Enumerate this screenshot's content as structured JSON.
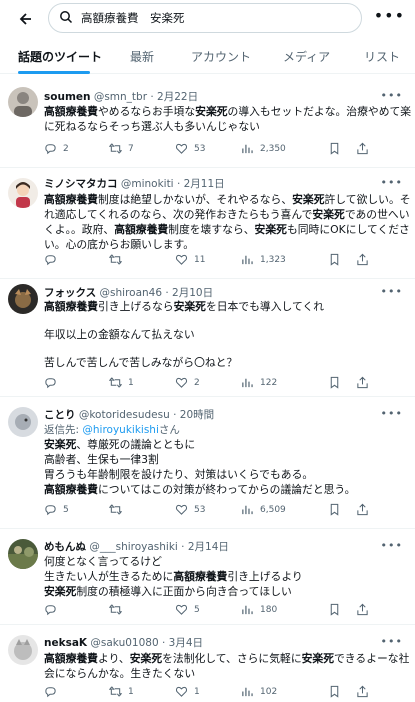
{
  "search": {
    "query": "高額療養費　安楽死"
  },
  "tabs": [
    "話題のツイート",
    "最新",
    "アカウント",
    "メディア",
    "リスト"
  ],
  "tweets": [
    {
      "name": "soumen",
      "handle": "@smn_tbr · 2月22日",
      "lines": [
        [
          {
            "t": "高額療養費",
            "b": true
          },
          {
            "t": "やめるならお手頃な"
          },
          {
            "t": "安楽死",
            "b": true
          },
          {
            "t": "の導入もセットだよな。治療やめて楽"
          }
        ],
        [
          {
            "t": "に死ねるならそっち選ぶ人も多いんじゃない"
          }
        ]
      ],
      "stats": {
        "reply": "2",
        "retweet": "7",
        "like": "53",
        "views": "2,350"
      }
    },
    {
      "name": "ミノシマタカコ",
      "handle": "@minokiti · 2月11日",
      "lines": [
        [
          {
            "t": "高額療養費",
            "b": true
          },
          {
            "t": "制度は絶望しかないが、それやるなら、"
          },
          {
            "t": "安楽死",
            "b": true
          },
          {
            "t": "許して欲しい。そ"
          }
        ],
        [
          {
            "t": "れ適応してくれるのなら、次の発作おきたらもう喜んで"
          },
          {
            "t": "安楽死",
            "b": true
          },
          {
            "t": "であの世へい"
          }
        ],
        [
          {
            "t": "くよ。。政府、"
          },
          {
            "t": "高額療養費",
            "b": true
          },
          {
            "t": "制度を壊すなら、"
          },
          {
            "t": "安楽死",
            "b": true
          },
          {
            "t": "も同時にOKにしてくださ"
          }
        ],
        [
          {
            "t": "い。心の底からお願いします。"
          }
        ]
      ],
      "stats": {
        "reply": "",
        "retweet": "",
        "like": "11",
        "views": "1,323"
      }
    },
    {
      "name": "フォックス",
      "handle": "@shiroan46 · 2月10日",
      "lines": [
        [
          {
            "t": "高額療養費",
            "b": true
          },
          {
            "t": "引き上げるなら"
          },
          {
            "t": "安楽死",
            "b": true
          },
          {
            "t": "を日本でも導入してくれ"
          }
        ],
        [],
        [
          {
            "t": "年収以上の金額なんて払えない"
          }
        ],
        [],
        [
          {
            "t": "苦しんで苦しんで苦しみながら〇ねと？"
          }
        ]
      ],
      "stats": {
        "reply": "",
        "retweet": "1",
        "like": "2",
        "views": "122"
      }
    },
    {
      "name": "ことり",
      "handle": "@kotoridesudesu · 20時間",
      "reply_prefix": "返信先: ",
      "reply_user": "@hiroyukikishi",
      "reply_suffix": "さん",
      "lines": [
        [
          {
            "t": "安楽死",
            "b": true
          },
          {
            "t": "、尊厳死の議論とともに"
          }
        ],
        [
          {
            "t": "高齢者、生保も一律3割"
          }
        ],
        [
          {
            "t": "胃ろうも年齢制限を設けたり、対策はいくらでもある。"
          }
        ],
        [
          {
            "t": "高額療養費",
            "b": true
          },
          {
            "t": "についてはこの対策が終わってからの議論だと思う。"
          }
        ]
      ],
      "stats": {
        "reply": "5",
        "retweet": "",
        "like": "53",
        "views": "6,509"
      }
    },
    {
      "name": "めもんぬ",
      "handle": "@___shiroyashiki · 2月14日",
      "lines": [
        [
          {
            "t": "何度となく言ってるけど"
          }
        ],
        [
          {
            "t": "生きたい人が生きるために"
          },
          {
            "t": "高額療養費",
            "b": true
          },
          {
            "t": "引き上げるより"
          }
        ],
        [
          {
            "t": "安楽死",
            "b": true
          },
          {
            "t": "制度の積極導入に正面から向き合ってほしい"
          }
        ]
      ],
      "stats": {
        "reply": "",
        "retweet": "",
        "like": "5",
        "views": "180"
      }
    },
    {
      "name": "neksaK",
      "handle": "@saku01080 · 3月4日",
      "lines": [
        [
          {
            "t": "高額療養費",
            "b": true
          },
          {
            "t": "より、"
          },
          {
            "t": "安楽死",
            "b": true
          },
          {
            "t": "を法制化して、さらに気軽に"
          },
          {
            "t": "安楽死",
            "b": true
          },
          {
            "t": "できるよーな社"
          }
        ],
        [
          {
            "t": "会にならんかな。生きたくない"
          }
        ]
      ],
      "stats": {
        "reply": "",
        "retweet": "1",
        "like": "1",
        "views": "102"
      }
    }
  ]
}
